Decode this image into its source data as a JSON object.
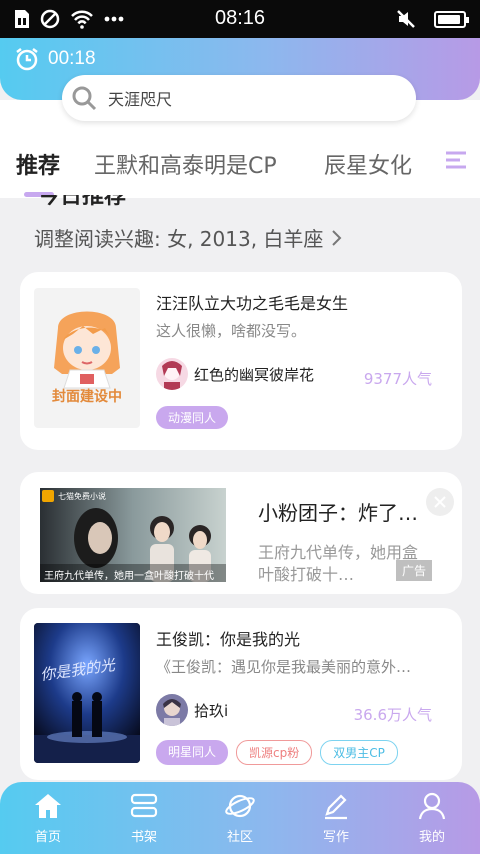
{
  "status_bar": {
    "time": "08:16",
    "battery_level": 0.9
  },
  "header": {
    "timer": "00:18",
    "search_placeholder": "天涯咫尺"
  },
  "tabs": [
    {
      "label": "推荐",
      "active": true
    },
    {
      "label": "王默和高泰明是CP",
      "active": false
    },
    {
      "label": "辰星女化",
      "active": false
    }
  ],
  "section": {
    "title": "今日推荐",
    "interest_line": "调整阅读兴趣: 女, 2013, 白羊座"
  },
  "books": [
    {
      "title": "汪汪队立大功之毛毛是女生",
      "description": "这人很懒，啥都没写。",
      "cover_text": "封面建设中",
      "author": "红色的幽冥彼岸花",
      "popularity": "9377人气",
      "tags": [
        "动漫同人"
      ]
    },
    {
      "title": "王俊凯：你是我的光",
      "description": "《王俊凯：遇见你是我最美丽的意外…",
      "cover_text": "你是我的光",
      "author": "拾玖i",
      "popularity": "36.6万人气",
      "tags": [
        "明星同人",
        "凯源cp粉",
        "双男主CP"
      ]
    }
  ],
  "ad": {
    "title": "小粉团子：炸了…",
    "description": "王府九代单传，她用盒叶酸打破十…",
    "label": "广告",
    "image_caption": "王府九代单传，她用一盒叶酸打破十代",
    "app_badge": "七猫免费小说"
  },
  "bottom_nav": [
    {
      "label": "首页",
      "icon": "home-icon"
    },
    {
      "label": "书架",
      "icon": "bookshelf-icon"
    },
    {
      "label": "社区",
      "icon": "planet-icon"
    },
    {
      "label": "写作",
      "icon": "pen-icon"
    },
    {
      "label": "我的",
      "icon": "user-icon"
    }
  ],
  "colors": {
    "gradient_start": "#55cbf0",
    "gradient_end": "#b79ae6",
    "accent_purple": "#c9a8ee"
  }
}
